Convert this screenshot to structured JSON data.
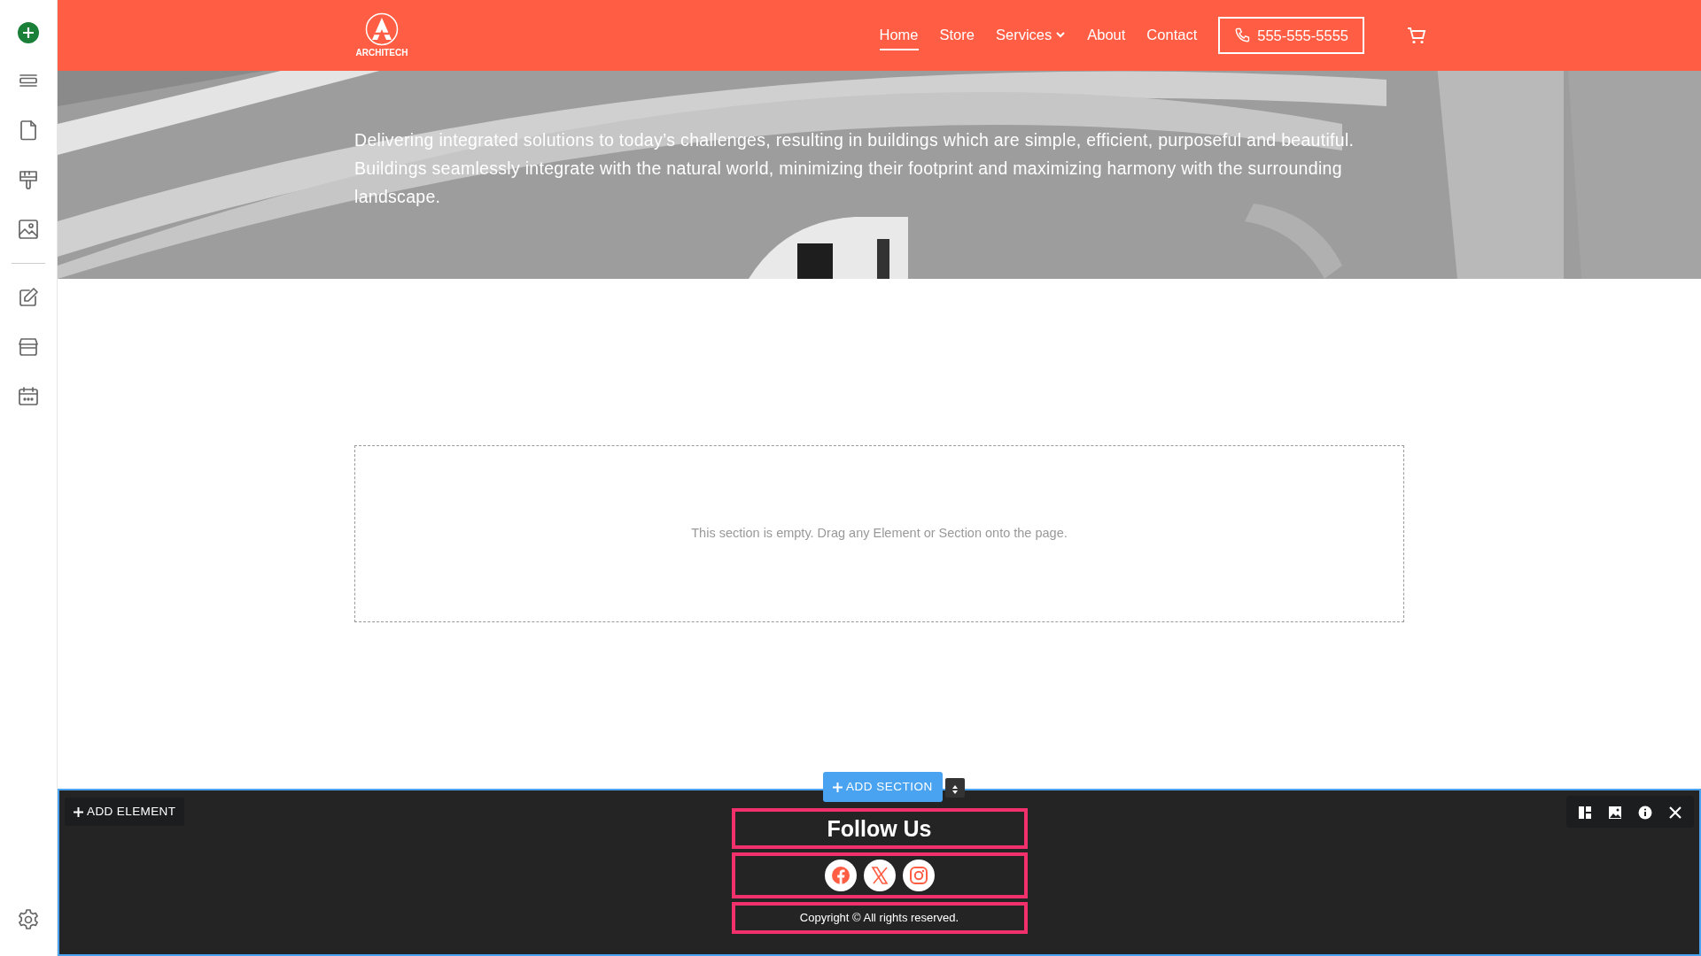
{
  "navbar": {
    "logo": "ARCHITECH",
    "links": [
      {
        "label": "Home",
        "selected": true,
        "has_menu": false
      },
      {
        "label": "Store",
        "selected": false,
        "has_menu": false
      },
      {
        "label": "Services",
        "selected": false,
        "has_menu": true
      },
      {
        "label": "About",
        "selected": false,
        "has_menu": false
      },
      {
        "label": "Contact",
        "selected": false,
        "has_menu": false
      }
    ],
    "phone": "555-555-5555"
  },
  "hero": {
    "text": "Delivering integrated solutions to today’s challenges, resulting in buildings which are simple, efficient, purposeful and beautiful. Buildings seamlessly integrate with the natural world, minimizing their footprint and maximizing harmony with the surrounding landscape."
  },
  "empty_section": {
    "message": "This section is empty. Drag any Element or Section onto the page."
  },
  "editor": {
    "add_section": "ADD SECTION",
    "add_element": "ADD ELEMENT"
  },
  "footer": {
    "heading": "Follow Us",
    "social": [
      {
        "kind": "facebook"
      },
      {
        "kind": "x"
      },
      {
        "kind": "instagram"
      }
    ],
    "copyright": "Copyright © All rights reserved."
  }
}
